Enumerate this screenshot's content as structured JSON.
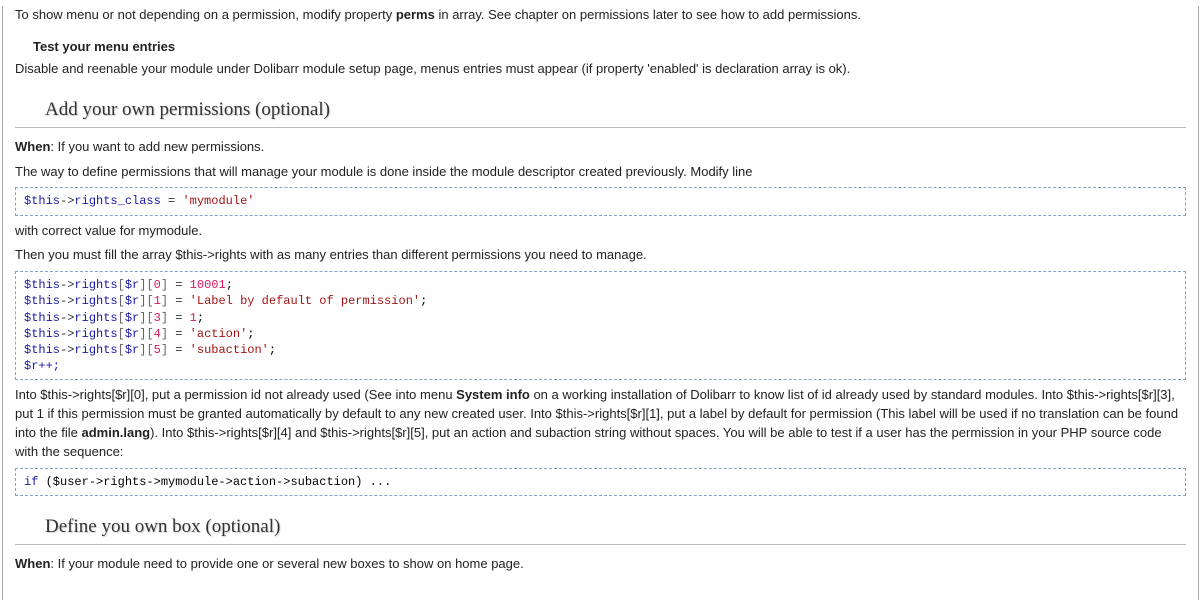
{
  "intro": {
    "perms_sentence_pre": "To show menu or not depending on a permission, modify property ",
    "perms_word": "perms",
    "perms_sentence_post": " in array. See chapter on permissions later to see how to add permissions."
  },
  "test_menu": {
    "heading": "Test your menu entries",
    "body": "Disable and reenable your module under Dolibarr module setup page, menus entries must appear (if property 'enabled' is declaration array is ok)."
  },
  "perms_section": {
    "heading": "Add your own permissions (optional)",
    "when_label": "When",
    "when_text": ": If you want to add new permissions.",
    "desc": "The way to define permissions that will manage your module is done inside the module descriptor created previously. Modify line",
    "code1": {
      "l1_var": "$this",
      "l1_prop": "rights_class",
      "l1_val": "'mymodule'"
    },
    "after_code1": "with correct value for mymodule.",
    "fill_array": "Then you must fill the array $this->rights with as many entries than different permissions you need to manage.",
    "code2": {
      "var": "$this",
      "prop": "rights",
      "idx": "$r",
      "val0": "10001",
      "val1": "'Label by default of permission'",
      "val3": "1",
      "val4": "'action'",
      "val5": "'subaction'",
      "inc": "$r++;"
    },
    "explain": {
      "t1": "Into $this->rights[$r][0], put a permission id not already used (See into menu ",
      "sysinfo": "System info",
      "t2": " on a working installation of Dolibarr to know list of id already used by standard modules. Into $this->rights[$r][1], put a label by default for permission (This label will be used if no translation can be found into the file ",
      "adminlang": "admin.lang",
      "t3": "). Into $this->rights[$r][4] and $this->rights[$r][5], put an action and subaction string without spaces. You will be able to test if a user has the permission in your PHP source code with the sequence:",
      "rights3": "Into $this->rights[$r][3], put 1 if this permission must be granted automatically by default to any new created user. "
    },
    "code3_prefix": "if",
    "code3_body": " ($user->rights->mymodule->action->subaction) ..."
  },
  "box_section": {
    "heading": "Define you own box (optional)",
    "when_label": "When",
    "when_text": ": If your module need to provide one or several new boxes to show on home page."
  }
}
